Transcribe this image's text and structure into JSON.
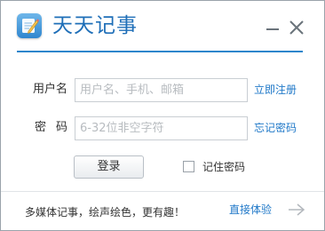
{
  "app": {
    "title": "天天记事",
    "icon": "notepad-pencil-icon"
  },
  "window_controls": {
    "minimize_icon": "minimize-icon",
    "close_icon": "close-icon"
  },
  "form": {
    "username_label": "用户名",
    "username_placeholder": "用户名、手机、邮箱",
    "password_label": "密码",
    "password_placeholder": "6-32位非空字符",
    "register_link": "立即注册",
    "forgot_link": "忘记密码",
    "login_button": "登录",
    "remember_label": "记住密码",
    "remember_checked": false
  },
  "footer": {
    "slogan": "多媒体记事，绘声绘色，更有趣！",
    "try_link": "直接体验",
    "arrow_icon": "arrow-right-icon"
  },
  "colors": {
    "accent": "#1f78c8",
    "title": "#1f6fb8",
    "divider": "#2d86cc"
  }
}
